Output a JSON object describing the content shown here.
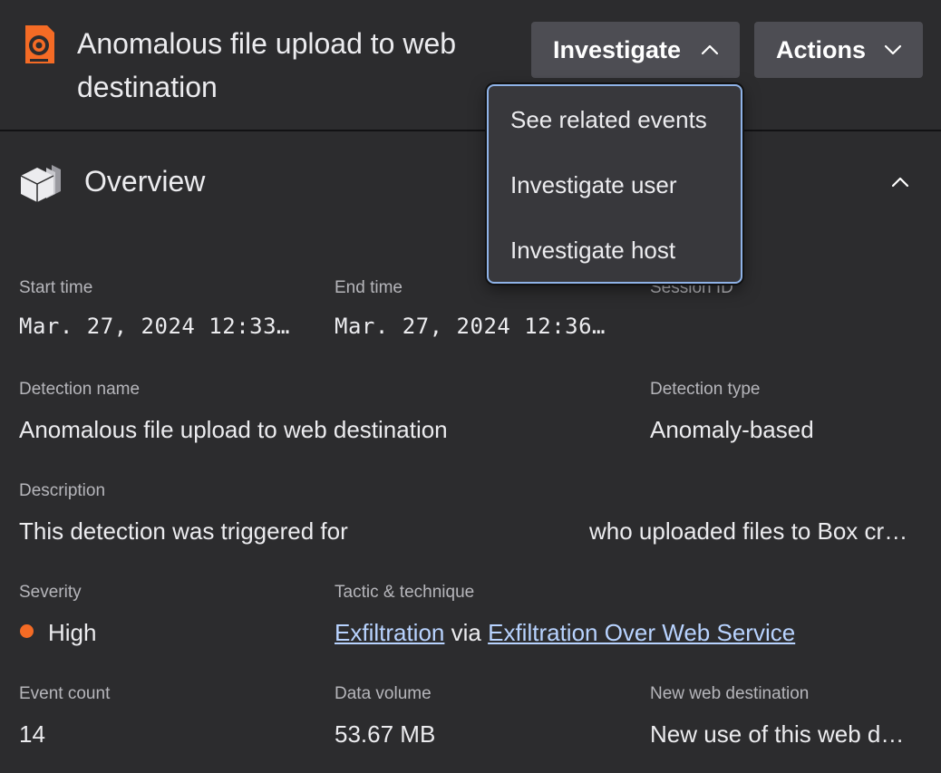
{
  "header": {
    "title": "Anomalous file upload to web destination",
    "icon": "alert-eye-icon",
    "accent_color": "#f46b25",
    "buttons": {
      "investigate": "Investigate",
      "actions": "Actions"
    }
  },
  "investigate_menu": {
    "items": [
      "See related events",
      "Investigate user",
      "Investigate host"
    ]
  },
  "overview": {
    "title": "Overview",
    "icon": "cubes-icon",
    "fields": {
      "start_time": {
        "label": "Start time",
        "value": "Mar. 27, 2024 12:33…"
      },
      "end_time": {
        "label": "End time",
        "value": "Mar. 27, 2024 12:36…"
      },
      "session_id": {
        "label": "Session ID",
        "value": ""
      },
      "detection_name": {
        "label": "Detection name",
        "value": "Anomalous file upload to web destination"
      },
      "detection_type": {
        "label": "Detection type",
        "value": "Anomaly-based"
      },
      "description": {
        "label": "Description",
        "value_before": "This detection was triggered for",
        "value_after": "who uploaded files to Box cr…"
      },
      "severity": {
        "label": "Severity",
        "value": "High",
        "color": "#f46b25"
      },
      "tactic": {
        "label": "Tactic & technique",
        "tactic_link": "Exfiltration",
        "joiner": "via",
        "technique_link": "Exfiltration Over Web Service"
      },
      "event_count": {
        "label": "Event count",
        "value": "14"
      },
      "data_volume": {
        "label": "Data volume",
        "value": "53.67 MB"
      },
      "new_web_destination": {
        "label": "New web destination",
        "value": "New use of this web d…"
      }
    }
  }
}
